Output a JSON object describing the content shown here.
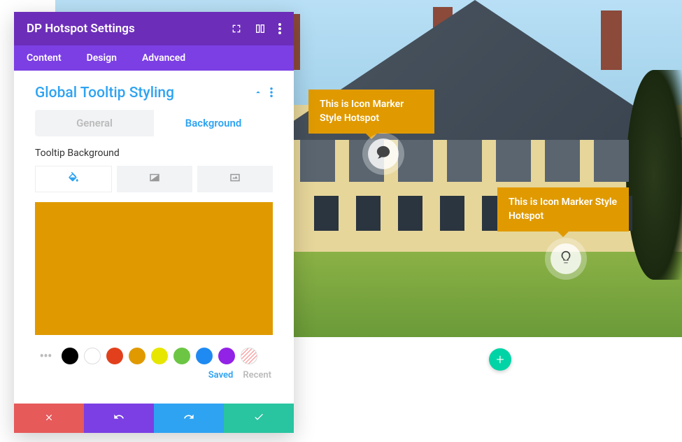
{
  "panel": {
    "title": "DP Hotspot Settings",
    "tabs": [
      "Content",
      "Design",
      "Advanced"
    ],
    "active_tab": 1
  },
  "section": {
    "title": "Global Tooltip Styling",
    "toggle": {
      "general": "General",
      "background": "Background",
      "active": "background"
    },
    "field_label": "Tooltip Background",
    "preview_color": "#e09a00",
    "swatches": [
      "#000000",
      "#ffffff",
      "#e2401c",
      "#e09a00",
      "#e6e600",
      "#6cc644",
      "#1f8af2",
      "#9222e6"
    ],
    "swatch_labels": {
      "saved": "Saved",
      "recent": "Recent"
    }
  },
  "preview": {
    "tooltip_text": "This is Icon Marker Style Hotspot"
  },
  "add_button": "+"
}
